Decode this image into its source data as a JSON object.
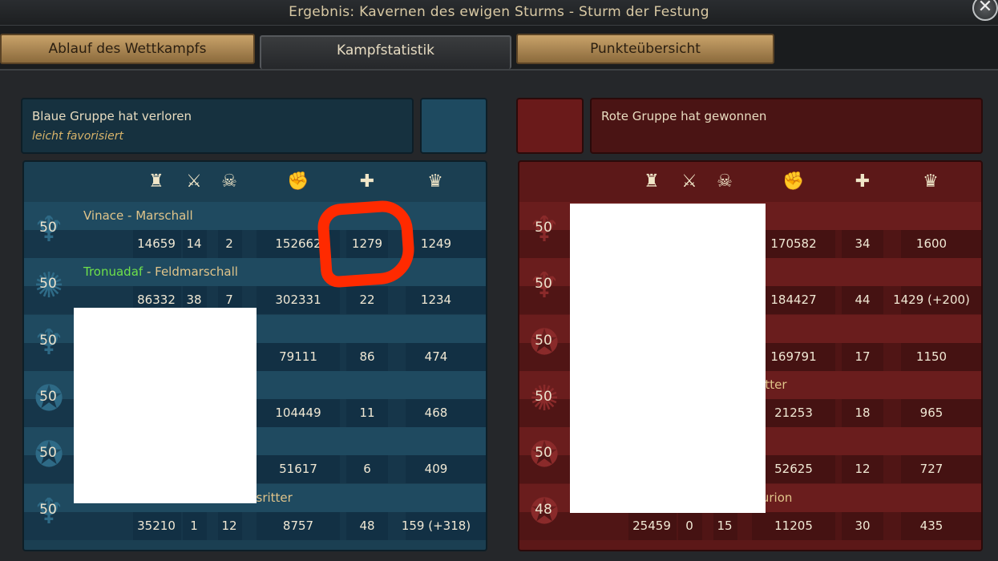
{
  "window": {
    "title": "Ergebnis: Kavernen des ewigen Sturms - Sturm der Festung",
    "close_glyph": "✕"
  },
  "tabs": [
    {
      "label": "Ablauf des Wettkampfs",
      "active": false
    },
    {
      "label": "Kampfstatistik",
      "active": true
    },
    {
      "label": "Punkteübersicht",
      "active": false
    }
  ],
  "columns": [
    "tower-icon",
    "crossed-swords-icon",
    "skull-icon",
    "fist-icon",
    "plus-icon",
    "crown-icon"
  ],
  "column_glyphs": [
    "♜",
    "⚔",
    "☠",
    "✊",
    "✚",
    "♛"
  ],
  "blue": {
    "result": "Blaue Gruppe hat verloren",
    "subtitle": "leicht favorisiert",
    "color": "#1b3f52",
    "players": [
      {
        "level": "50",
        "name": "Vinace",
        "sep": " - ",
        "rank": "Marschall",
        "stats": [
          "14659",
          "14",
          "2",
          "152662",
          "1279",
          "1249"
        ]
      },
      {
        "level": "50",
        "name": "Tronuadaf",
        "sep": " - ",
        "rank": "Feldmarschall",
        "stats": [
          "86332",
          "38",
          "7",
          "302331",
          "22",
          "1234"
        ]
      },
      {
        "level": "50",
        "name": "",
        "sep": "",
        "rank": "",
        "stats": [
          "",
          "",
          "",
          "79111",
          "86",
          "474"
        ]
      },
      {
        "level": "50",
        "name": "",
        "sep": "",
        "rank": "",
        "stats": [
          "",
          "",
          "",
          "104449",
          "11",
          "468"
        ]
      },
      {
        "level": "50",
        "name": "",
        "sep": "",
        "rank": "",
        "stats": [
          "",
          "",
          "",
          "51617",
          "6",
          "409"
        ]
      },
      {
        "level": "50",
        "name": "",
        "sep": "",
        "rank": "nsritter",
        "stats": [
          "35210",
          "1",
          "12",
          "8757",
          "48",
          "159 (+318)"
        ]
      }
    ]
  },
  "red": {
    "result": "Rote Gruppe hat gewonnen",
    "color": "#5c1818",
    "players": [
      {
        "level": "50",
        "rank": "",
        "stats": [
          "",
          "",
          "",
          "170582",
          "34",
          "1600"
        ]
      },
      {
        "level": "50",
        "rank": "",
        "stats": [
          "",
          "",
          "",
          "184427",
          "44",
          "1429 (+200)"
        ]
      },
      {
        "level": "50",
        "rank": "",
        "stats": [
          "",
          "",
          "",
          "169791",
          "17",
          "1150"
        ]
      },
      {
        "level": "50",
        "rank": "ritter",
        "stats": [
          "",
          "",
          "",
          "21253",
          "18",
          "965"
        ]
      },
      {
        "level": "50",
        "rank": "",
        "stats": [
          "",
          "",
          "",
          "52625",
          "12",
          "727"
        ]
      },
      {
        "level": "48",
        "rank": "turion",
        "stats": [
          "25459",
          "0",
          "15",
          "11205",
          "30",
          "435"
        ]
      }
    ]
  }
}
